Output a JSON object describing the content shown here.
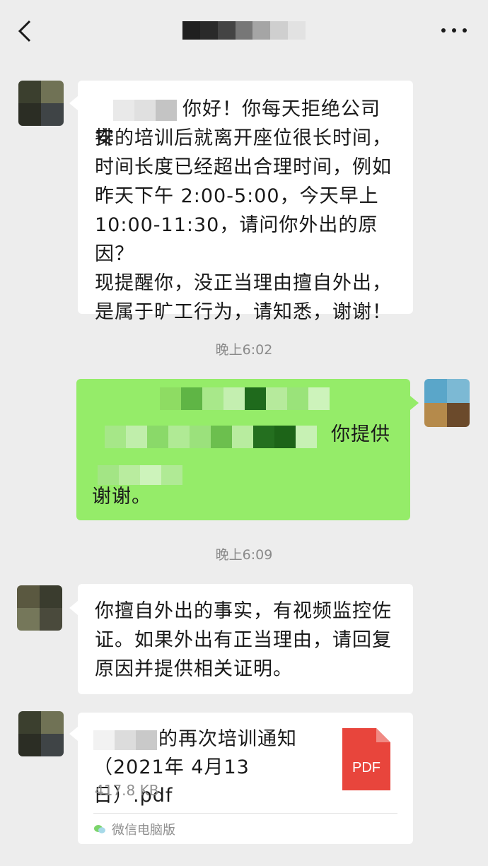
{
  "header": {
    "title": "",
    "back_icon": "chevron-left-icon",
    "more_icon": "more-dots-icon"
  },
  "messages": [
    {
      "direction": "in",
      "name_hidden": "",
      "lines": [
        "你好！你每天拒绝公司安",
        "排的培训后就离开座位很长时间，",
        "时间长度已经超出合理时间，例如",
        "昨天下午 2:00-5:00，今天早上",
        "10:00-11:30，请问你外出的原因？",
        "现提醒你，没正当理由擅自外出，",
        "是属于旷工行为，请知悉，谢谢！"
      ]
    },
    {
      "direction": "out",
      "visible_text_1": "你提供",
      "visible_text_2": "谢谢。"
    },
    {
      "direction": "in",
      "lines": [
        "你擅自外出的事实，有视频监控佐",
        "证。如果外出有正当理由，请回复",
        "原因并提供相关证明。"
      ]
    }
  ],
  "timestamps": [
    "晚上6:02",
    "晚上6:09"
  ],
  "file": {
    "name_line1": "的再次培训通知",
    "name_line2": "（2021年 4月13日）.pdf",
    "size": "417.8 KB",
    "icon_label": "PDF",
    "source": "微信电脑版",
    "icon_color": "#e8453c"
  },
  "colors": {
    "background": "#ededed",
    "incoming_bubble": "#ffffff",
    "outgoing_bubble": "#95ec69",
    "timestamp_text": "#8a8a8a"
  }
}
